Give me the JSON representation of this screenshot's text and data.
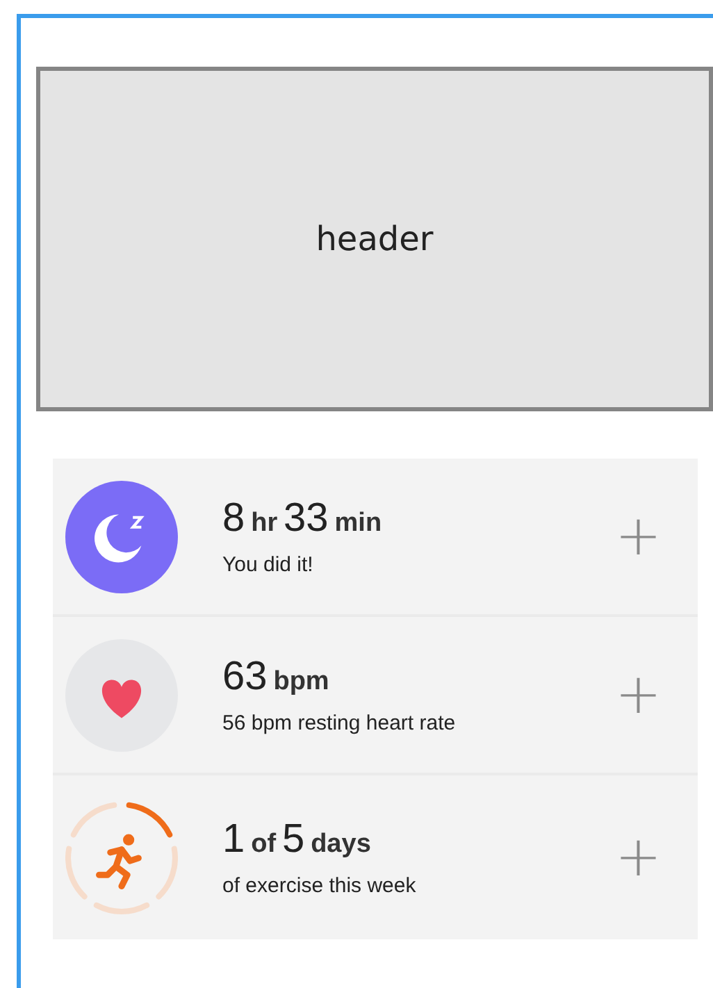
{
  "header": {
    "label": "header"
  },
  "stats": [
    {
      "kind": "sleep",
      "headline": [
        {
          "text": "8",
          "kind": "number"
        },
        {
          "text": "hr",
          "kind": "unit"
        },
        {
          "text": "33",
          "kind": "number"
        },
        {
          "text": "min",
          "kind": "unit"
        }
      ],
      "caption": "You did it!",
      "action": "+"
    },
    {
      "kind": "heart",
      "headline": [
        {
          "text": "63",
          "kind": "number"
        },
        {
          "text": "bpm",
          "kind": "unit"
        }
      ],
      "caption": "56 bpm resting heart rate",
      "action": "+"
    },
    {
      "kind": "exercise",
      "ring_segments": [
        {
          "filled": true
        },
        {
          "filled": false
        },
        {
          "filled": false
        },
        {
          "filled": false
        },
        {
          "filled": false
        }
      ],
      "headline": [
        {
          "text": "1",
          "kind": "number"
        },
        {
          "text": "of",
          "kind": "unit"
        },
        {
          "text": "5",
          "kind": "number"
        },
        {
          "text": "days",
          "kind": "unit"
        }
      ],
      "caption": "of exercise this week",
      "action": "+"
    }
  ]
}
